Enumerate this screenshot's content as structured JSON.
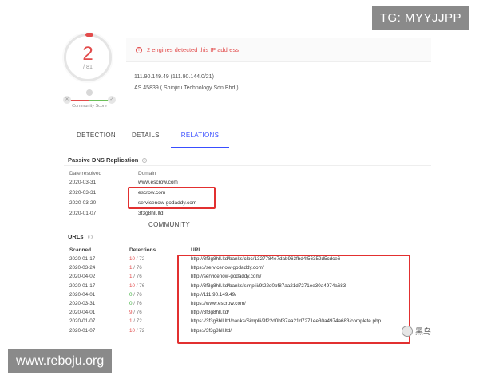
{
  "watermark": {
    "top": "TG: MYYJJPP",
    "bottom": "www.reboju.org",
    "logo": "黑鸟"
  },
  "score": {
    "value": "2",
    "total": "/ 81",
    "community_label": "Community Score"
  },
  "detection_banner": "2 engines detected this IP address",
  "ip_info": {
    "line1": "111.90.149.49  (111.90.144.0/21)",
    "line2": "AS 45839 ( Shinjiru Technology Sdn Bhd )"
  },
  "tabs": [
    {
      "label": "DETECTION"
    },
    {
      "label": "DETAILS"
    },
    {
      "label": "RELATIONS"
    },
    {
      "label": "COMMUNITY"
    }
  ],
  "passive_dns": {
    "title": "Passive DNS Replication",
    "col_date": "Date resolved",
    "col_domain": "Domain",
    "rows": [
      {
        "date": "2020-03-31",
        "domain": "www.escrow.com"
      },
      {
        "date": "2020-03-31",
        "domain": "escrow.com"
      },
      {
        "date": "2020-03-20",
        "domain": "servicenow-godaddy.com"
      },
      {
        "date": "2020-01-07",
        "domain": "3f3g8hll.ltd"
      }
    ]
  },
  "urls": {
    "title": "URLs",
    "col_scanned": "Scanned",
    "col_detections": "Detections",
    "col_url": "URL",
    "rows": [
      {
        "scanned": "2020-01-17",
        "det": "10",
        "of": "/ 72",
        "tone": "red",
        "url": "http://3f3g8hll.ltd/banks/cibc/1327784e7dab963fbd4f56352d5cdce6"
      },
      {
        "scanned": "2020-03-24",
        "det": "1",
        "of": "/ 76",
        "tone": "red",
        "url": "https://servicenow-godaddy.com/"
      },
      {
        "scanned": "2020-04-02",
        "det": "1",
        "of": "/ 76",
        "tone": "red",
        "url": "http://servicenow-godaddy.com/"
      },
      {
        "scanned": "2020-01-17",
        "det": "10",
        "of": "/ 76",
        "tone": "red",
        "url": "http://3f3g8hll.ltd/banks/simplii/9f22d0bf87aa21d7271ee30a4974a683"
      },
      {
        "scanned": "2020-04-01",
        "det": "0",
        "of": "/ 76",
        "tone": "green",
        "url": "http://111.90.149.49/"
      },
      {
        "scanned": "2020-03-31",
        "det": "0",
        "of": "/ 76",
        "tone": "green",
        "url": "https://www.escrow.com/"
      },
      {
        "scanned": "2020-04-01",
        "det": "9",
        "of": "/ 76",
        "tone": "red",
        "url": "http://3f3g8hll.ltd/"
      },
      {
        "scanned": "2020-01-07",
        "det": "1",
        "of": "/ 72",
        "tone": "red",
        "url": "https://3f3g8hll.ltd/banks/Simplii/9f22d0bf87aa21d7271ee30a4974a683/complete.php"
      },
      {
        "scanned": "2020-01-07",
        "det": "10",
        "of": "/ 72",
        "tone": "red",
        "url": "https://3f3g8hll.ltd/"
      }
    ]
  },
  "colors": {
    "alert": "#e24b4b",
    "clean": "#3cae3c",
    "tab_active": "#394eff",
    "highlight": "#e23030"
  }
}
